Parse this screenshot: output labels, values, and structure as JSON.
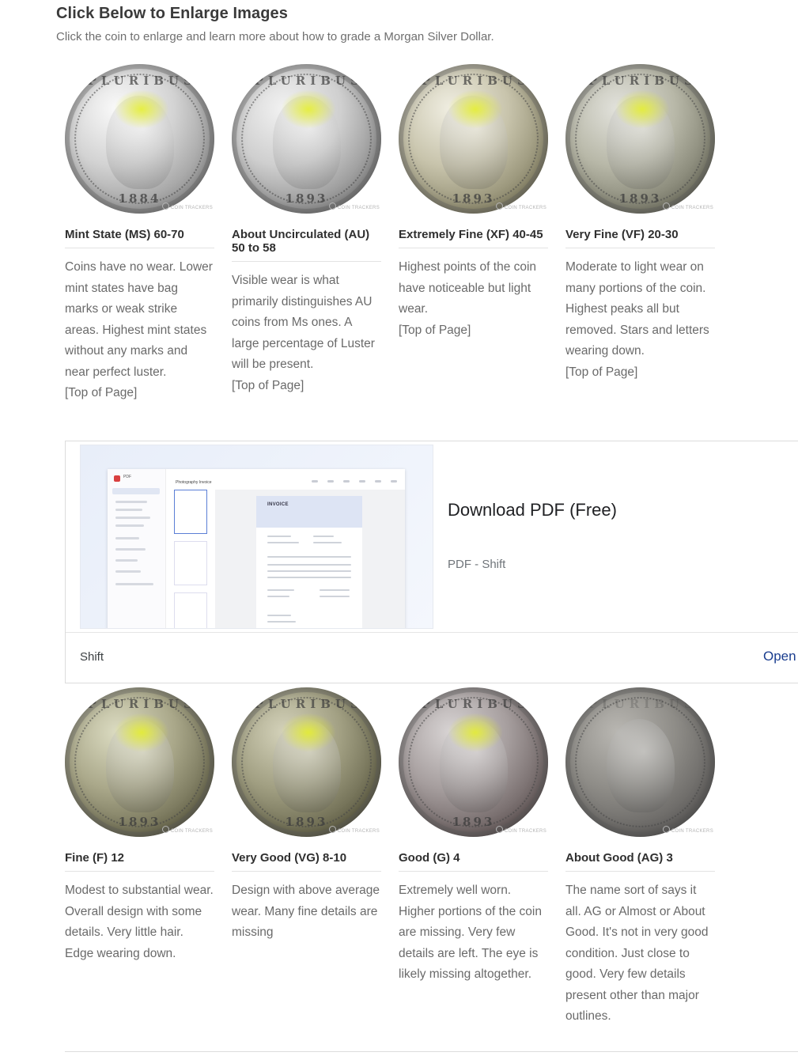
{
  "section": {
    "title": "Click Below to Enlarge Images",
    "subtitle": "Click the coin to enlarge and learn more about how to grade a Morgan Silver Dollar."
  },
  "coin_legend": "E·PLURIBUS·UNUM",
  "watermark": "COIN TRACKERS",
  "top_link": "[Top of Page]",
  "grades_row1": [
    {
      "year": "1884",
      "title": "Mint State (MS) 60-70",
      "desc": "Coins have no wear. Lower mint states have bag marks or weak strike areas. Highest mint states without any marks and near perfect luster."
    },
    {
      "year": "1893",
      "title": "About Uncirculated (AU) 50 to 58",
      "desc": "Visible wear is what primarily distinguishes AU coins from Ms ones. A large percentage of Luster will be present."
    },
    {
      "year": "1893",
      "title": "Extremely Fine (XF) 40-45",
      "desc": "Highest points of the coin have noticeable but light wear."
    },
    {
      "year": "1893",
      "title": "Very Fine (VF) 20-30",
      "desc": "Moderate to light wear on many portions of the coin. Highest peaks all but removed. Stars and letters wearing down."
    }
  ],
  "grades_row2": [
    {
      "year": "1893",
      "title": "Fine (F) 12",
      "desc": "Modest to substantial wear. Overall design with some details. Very little hair. Edge wearing down."
    },
    {
      "year": "1893",
      "title": "Very Good (VG) 8-10",
      "desc": "Design with above average wear. Many fine details are missing"
    },
    {
      "year": "1893",
      "title": "Good (G) 4",
      "desc": "Extremely well worn. Higher portions of the coin are missing. Very few details are left. The eye is likely missing altogether."
    },
    {
      "year": "",
      "title": "About Good (AG) 3",
      "desc": "The name sort of says it all. AG or Almost or About Good. It's not in very good condition. Just close to good. Very few details present other than major outlines."
    }
  ],
  "ad": {
    "title": "Download PDF (Free)",
    "source": "PDF - Shift",
    "brand": "Shift",
    "cta": "Open",
    "preview": {
      "app_label": "PDF",
      "doc_title": "Photography Invoice",
      "invoice_heading": "INVOICE"
    }
  },
  "colors": {
    "title": "#3a3a3a",
    "body_text": "#6a6a6a",
    "ad_cta": "#1a3d8f",
    "highlight": "#e6f028"
  }
}
